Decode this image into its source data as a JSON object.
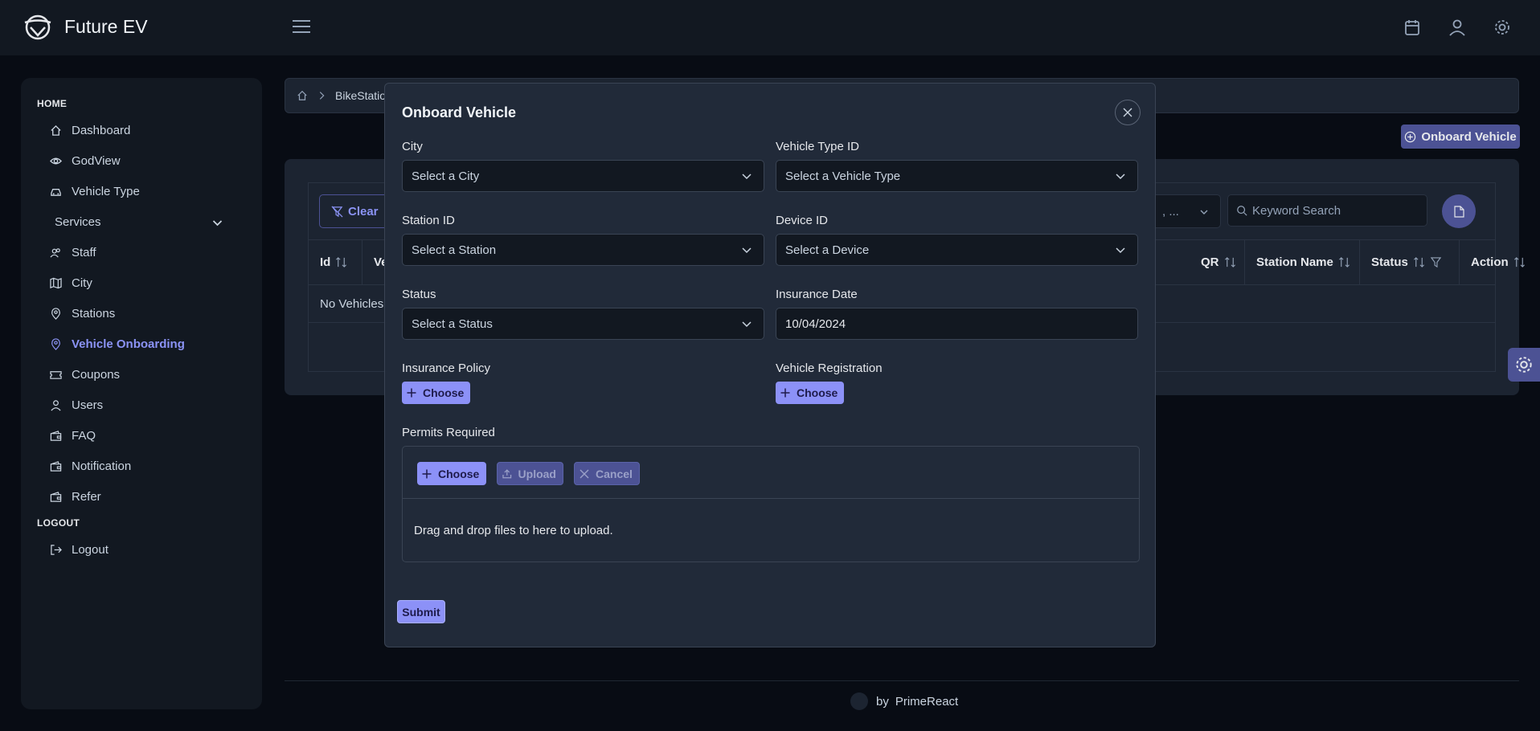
{
  "app": {
    "title": "Future EV"
  },
  "sidebar": {
    "sections": [
      {
        "label": "HOME",
        "items": [
          {
            "label": "Dashboard",
            "icon": "home-icon"
          },
          {
            "label": "GodView",
            "icon": "eye-icon"
          },
          {
            "label": "Vehicle Type",
            "icon": "car-icon"
          },
          {
            "label": "Services",
            "icon": "chevron-down-icon"
          },
          {
            "label": "Staff",
            "icon": "users-icon"
          },
          {
            "label": "City",
            "icon": "map-icon"
          },
          {
            "label": "Stations",
            "icon": "map-marker-icon"
          },
          {
            "label": "Vehicle Onboarding",
            "icon": "map-marker-icon",
            "active": true
          },
          {
            "label": "Coupons",
            "icon": "ticket-icon"
          },
          {
            "label": "Users",
            "icon": "user-icon"
          },
          {
            "label": "FAQ",
            "icon": "wallet-icon"
          },
          {
            "label": "Notification",
            "icon": "wallet-icon"
          },
          {
            "label": "Refer",
            "icon": "wallet-icon"
          }
        ]
      },
      {
        "label": "LOGOUT",
        "items": [
          {
            "label": "Logout",
            "icon": "sign-out-icon"
          }
        ]
      }
    ]
  },
  "breadcrumb": {
    "text": "BikeStatio"
  },
  "page": {
    "onboard_button": "Onboard Vehicle",
    "clear_button": "Clear",
    "column_select": ", ...",
    "search_placeholder": "Keyword Search",
    "table": {
      "columns_left": [
        "Id",
        "Ve"
      ],
      "columns_right": [
        "QR",
        "Station Name",
        "Status",
        "Action"
      ],
      "empty_message": "No Vehicles"
    }
  },
  "footer": {
    "by": "by",
    "brand": "PrimeReact"
  },
  "modal": {
    "title": "Onboard Vehicle",
    "fields": {
      "city": {
        "label": "City",
        "placeholder": "Select a City"
      },
      "vehicle_type": {
        "label": "Vehicle Type ID",
        "placeholder": "Select a Vehicle Type"
      },
      "station": {
        "label": "Station ID",
        "placeholder": "Select a Station"
      },
      "device": {
        "label": "Device ID",
        "placeholder": "Select a Device"
      },
      "status": {
        "label": "Status",
        "placeholder": "Select a Status"
      },
      "insurance_date": {
        "label": "Insurance Date",
        "value": "10/04/2024"
      },
      "insurance_policy": {
        "label": "Insurance Policy",
        "button": "Choose"
      },
      "vehicle_registration": {
        "label": "Vehicle Registration",
        "button": "Choose"
      },
      "permits": {
        "label": "Permits Required",
        "choose": "Choose",
        "upload": "Upload",
        "cancel": "Cancel",
        "drop_text": "Drag and drop files to here to upload."
      }
    },
    "submit": "Submit"
  },
  "colors": {
    "accent": "#8c91f7",
    "accent_dark": "#4c5294",
    "bg": "#080c14",
    "panel": "#121821",
    "modal": "#212a39"
  }
}
